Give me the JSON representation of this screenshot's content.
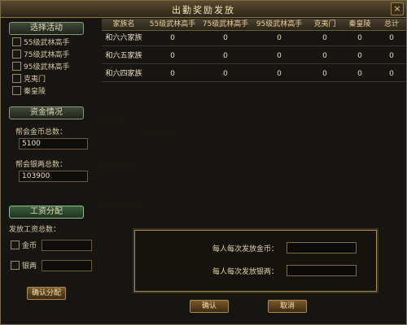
{
  "window": {
    "title": "出勤奖励发放",
    "close_label": "×"
  },
  "left": {
    "select_header": "选择活动",
    "activities": [
      {
        "label": "55级武林高手"
      },
      {
        "label": "75级武林高手"
      },
      {
        "label": "95级武林高手"
      },
      {
        "label": "克夷门"
      },
      {
        "label": "秦皇陵"
      }
    ],
    "funds_header": "资金情况",
    "gold_total_label": "帮会金币总数：",
    "gold_total_value": "5100",
    "silver_total_label": "帮会银两总数：",
    "silver_total_value": "103900",
    "salary_header": "工资分配",
    "salary_total_label": "发放工资总数：",
    "gold_checkbox_label": "金币",
    "silver_checkbox_label": "银两",
    "confirm_alloc_label": "确认分配"
  },
  "table": {
    "columns": [
      "家族名",
      "55级武林高手",
      "75级武林高手",
      "95级武林高手",
      "克夷门",
      "秦皇陵",
      "总计"
    ],
    "rows": [
      [
        "和六六家族",
        "0",
        "0",
        "0",
        "0",
        "0",
        "0"
      ],
      [
        "和六五家族",
        "0",
        "0",
        "0",
        "0",
        "0",
        "0"
      ],
      [
        "和六四家族",
        "0",
        "0",
        "0",
        "0",
        "0",
        "0"
      ]
    ]
  },
  "dialog": {
    "gold_label": "每人每次发放金币：",
    "silver_label": "每人每次发放银两：",
    "ok_label": "确认",
    "cancel_label": "取消"
  }
}
